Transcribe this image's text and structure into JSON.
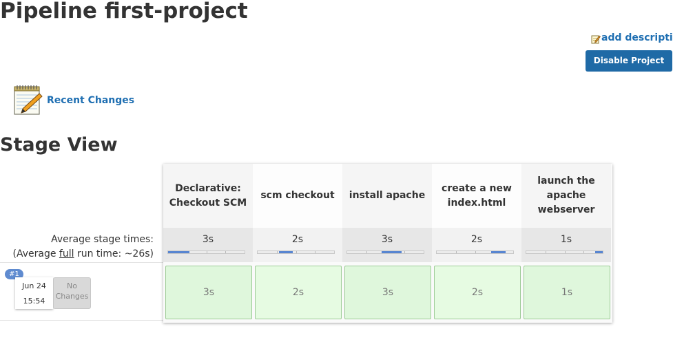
{
  "page": {
    "title": "Pipeline first-project",
    "add_description": "add description",
    "disable_button": "Disable Project",
    "recent_changes": "Recent Changes",
    "stage_view_title": "Stage View"
  },
  "stage_view": {
    "average_label": "Average stage times:",
    "full_runtime_prefix": "(Average ",
    "full_runtime_word": "full",
    "full_runtime_suffix": " run time: ~26s)",
    "stages": [
      {
        "name": "Declarative: Checkout SCM",
        "avg": "3s",
        "bar_start": 0.0,
        "bar_fraction": 0.28
      },
      {
        "name": "scm checkout",
        "avg": "2s",
        "bar_start": 0.28,
        "bar_fraction": 0.18
      },
      {
        "name": "install apache",
        "avg": "3s",
        "bar_start": 0.45,
        "bar_fraction": 0.26
      },
      {
        "name": "create a new index.html",
        "avg": "2s",
        "bar_start": 0.71,
        "bar_fraction": 0.19
      },
      {
        "name": "launch the apache webserver",
        "avg": "1s",
        "bar_start": 0.9,
        "bar_fraction": 0.1
      }
    ],
    "runs": [
      {
        "number": "#1",
        "date": "Jun 24",
        "time": "15:54",
        "changes": "No Changes",
        "cells": [
          "3s",
          "2s",
          "3s",
          "2s",
          "1s"
        ]
      }
    ]
  }
}
